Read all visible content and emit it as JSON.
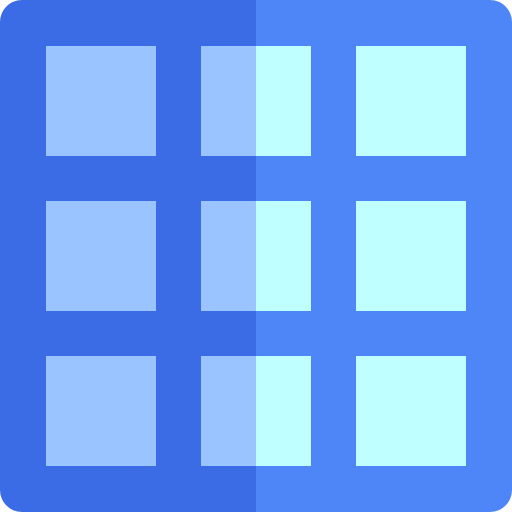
{
  "icon": {
    "name": "grid-icon",
    "rows": 3,
    "columns": 3,
    "colors": {
      "frame_left": "#3b6ce6",
      "frame_right": "#4f86f7",
      "cell_left": "#99c4ff",
      "cell_right": "#c0ffff"
    }
  }
}
